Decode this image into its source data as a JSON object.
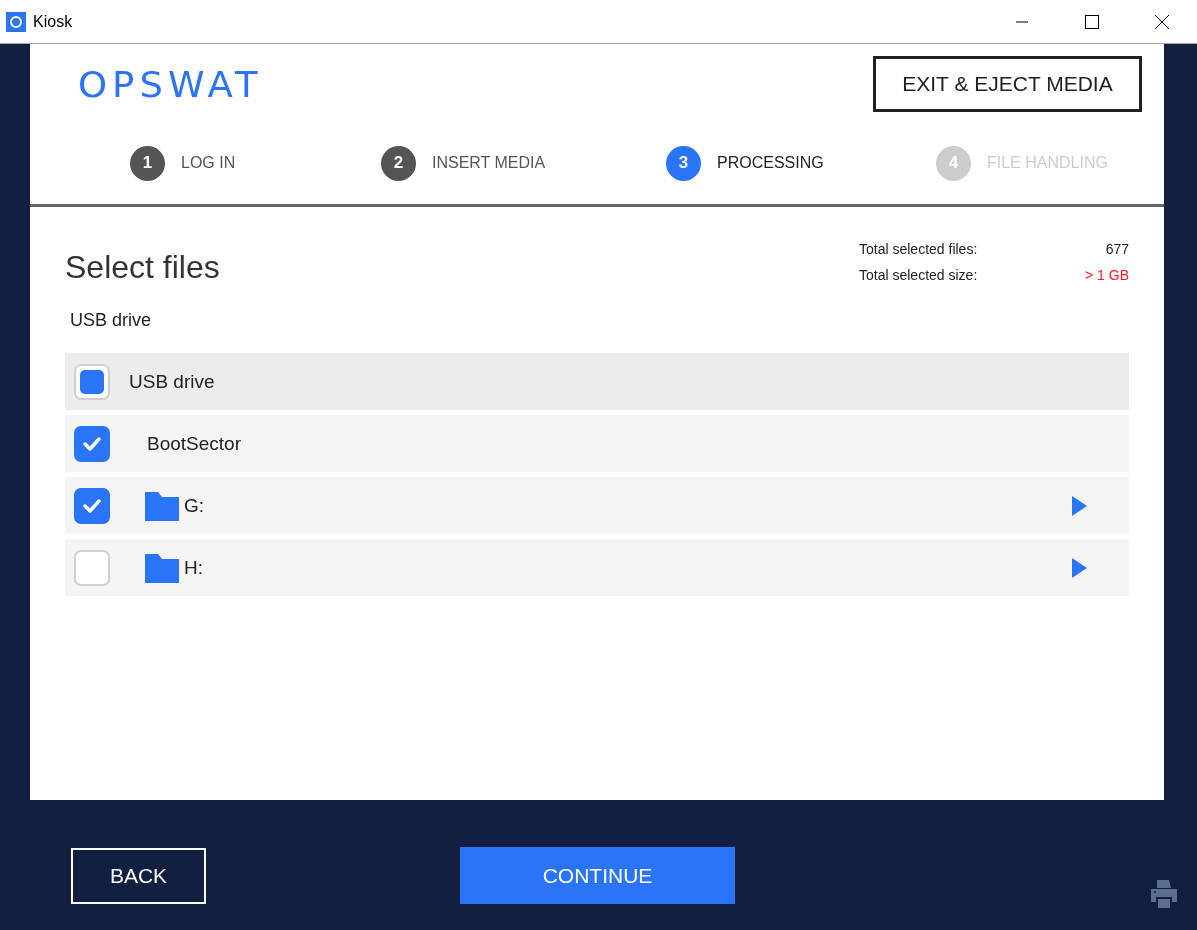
{
  "window": {
    "title": "Kiosk"
  },
  "header": {
    "logo": "OPSWAT",
    "exit_button": "EXIT & EJECT MEDIA"
  },
  "steps": [
    {
      "number": "1",
      "label": "LOG IN",
      "selected": false,
      "disabled": false
    },
    {
      "number": "2",
      "label": "INSERT MEDIA",
      "selected": false,
      "disabled": false
    },
    {
      "number": "3",
      "label": "PROCESSING",
      "selected": true,
      "disabled": false
    },
    {
      "number": "4",
      "label": "FILE HANDLING",
      "selected": false,
      "disabled": true
    }
  ],
  "content": {
    "title": "Select files",
    "stats": [
      {
        "label": "Total selected files:",
        "value": "677",
        "warning": false
      },
      {
        "label": "Total selected size:",
        "value": "> 1 GB",
        "warning": true
      }
    ],
    "source_label": "USB drive",
    "tree": {
      "label": "USB drive",
      "checked": false,
      "indeterminate": true,
      "children": [
        {
          "label": "BootSector",
          "kind": "file",
          "checked": true
        },
        {
          "label": "G:",
          "kind": "folder",
          "checked": true
        },
        {
          "label": "H:",
          "kind": "folder",
          "checked": false
        }
      ]
    }
  },
  "footer": {
    "back_button": "BACK",
    "continue_button": "CONTINUE"
  }
}
